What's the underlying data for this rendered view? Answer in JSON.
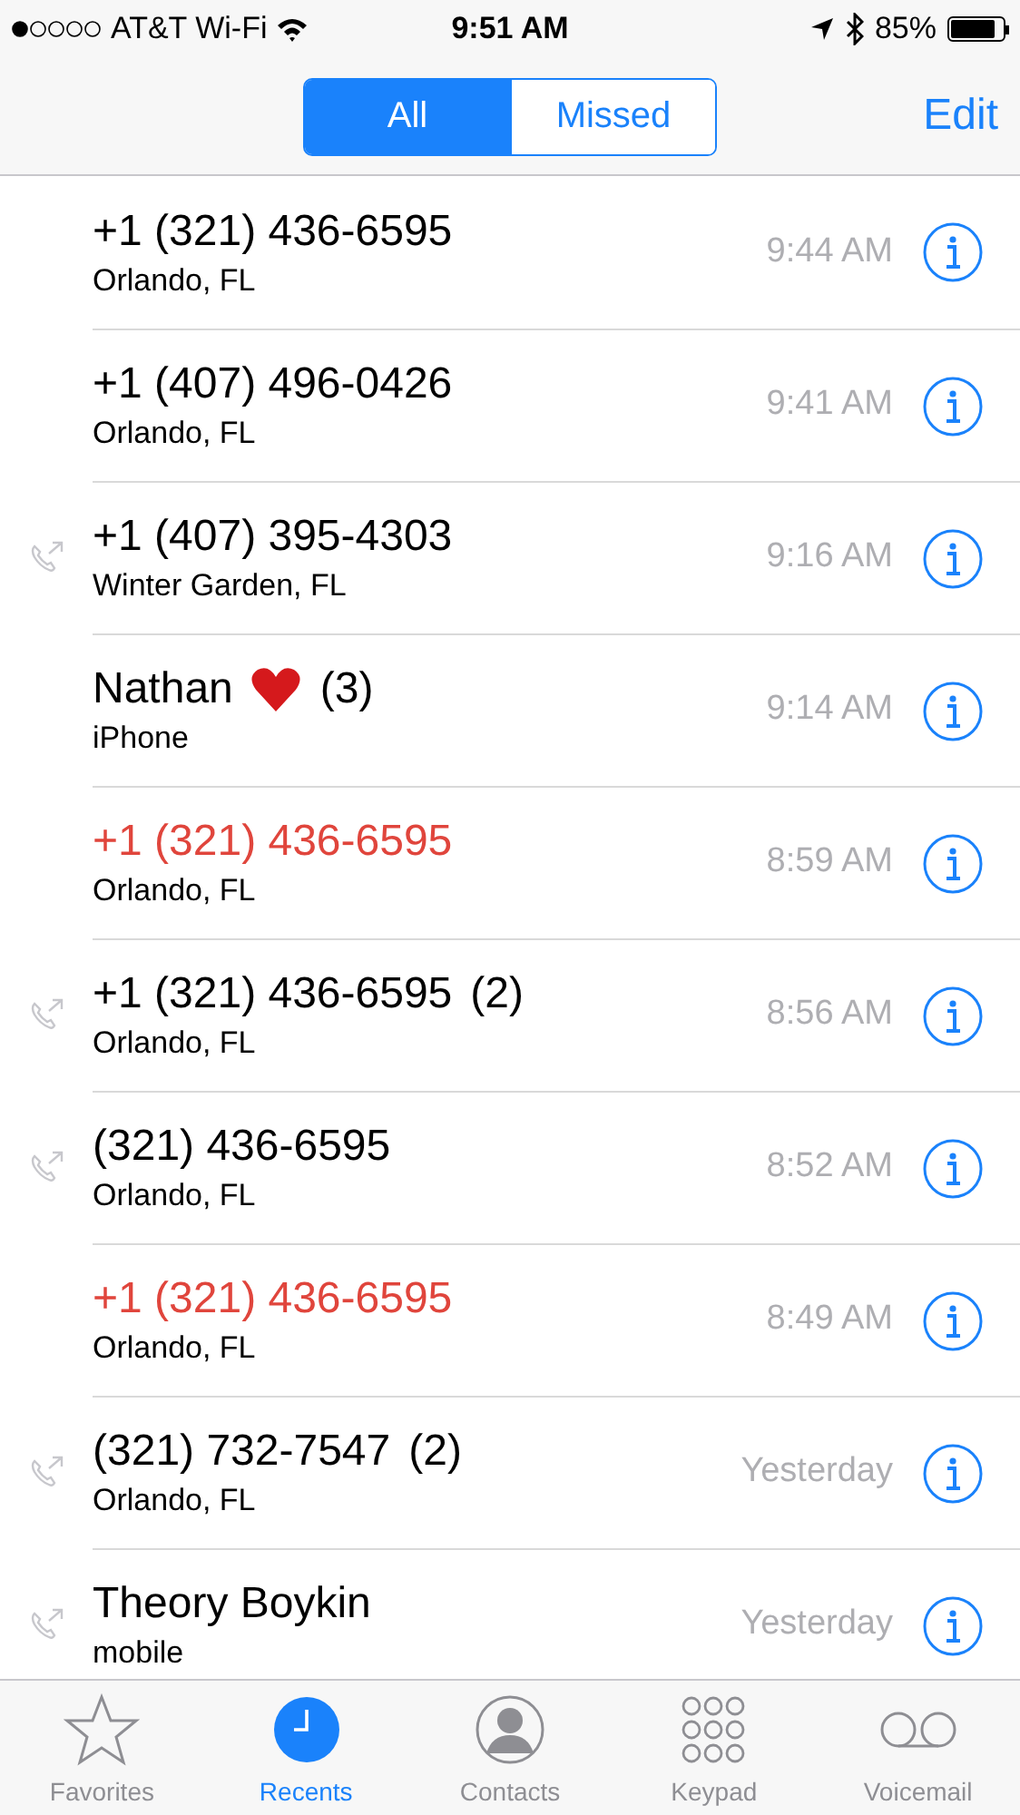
{
  "status_bar": {
    "carrier": "AT&T Wi-Fi",
    "time": "9:51 AM",
    "battery": "85%"
  },
  "segments": [
    {
      "label": "All",
      "selected": true
    },
    {
      "label": "Missed",
      "selected": false
    }
  ],
  "edit": "Edit",
  "calls": [
    {
      "name": "+1 (321) 436-6595",
      "subtitle": "Orlando, FL",
      "time": "9:44 AM",
      "missed": false,
      "outgoing": false
    },
    {
      "name": "+1 (407) 496-0426",
      "subtitle": "Orlando, FL",
      "time": "9:41 AM",
      "missed": false,
      "outgoing": false
    },
    {
      "name": "+1 (407) 395-4303",
      "subtitle": "Winter Garden, FL",
      "time": "9:16 AM",
      "missed": false,
      "outgoing": true
    },
    {
      "name": "Nathan",
      "heart": true,
      "count": "(3)",
      "subtitle": "iPhone",
      "time": "9:14 AM",
      "missed": false,
      "outgoing": false
    },
    {
      "name": "+1 (321) 436-6595",
      "subtitle": "Orlando, FL",
      "time": "8:59 AM",
      "missed": true,
      "outgoing": false
    },
    {
      "name": "+1 (321) 436-6595",
      "count": "(2)",
      "subtitle": "Orlando, FL",
      "time": "8:56 AM",
      "missed": false,
      "outgoing": true
    },
    {
      "name": "(321) 436-6595",
      "subtitle": "Orlando, FL",
      "time": "8:52 AM",
      "missed": false,
      "outgoing": true
    },
    {
      "name": "+1 (321) 436-6595",
      "subtitle": "Orlando, FL",
      "time": "8:49 AM",
      "missed": true,
      "outgoing": false
    },
    {
      "name": "(321) 732-7547",
      "count": "(2)",
      "subtitle": "Orlando, FL",
      "time": "Yesterday",
      "missed": false,
      "outgoing": true
    },
    {
      "name": "Theory Boykin",
      "subtitle": "mobile",
      "time": "Yesterday",
      "missed": false,
      "outgoing": true
    }
  ],
  "tabs": [
    {
      "label": "Favorites",
      "kind": "star",
      "selected": false
    },
    {
      "label": "Recents",
      "kind": "clock",
      "selected": true
    },
    {
      "label": "Contacts",
      "kind": "person",
      "selected": false
    },
    {
      "label": "Keypad",
      "kind": "keypad",
      "selected": false
    },
    {
      "label": "Voicemail",
      "kind": "voicemail",
      "selected": false
    }
  ]
}
